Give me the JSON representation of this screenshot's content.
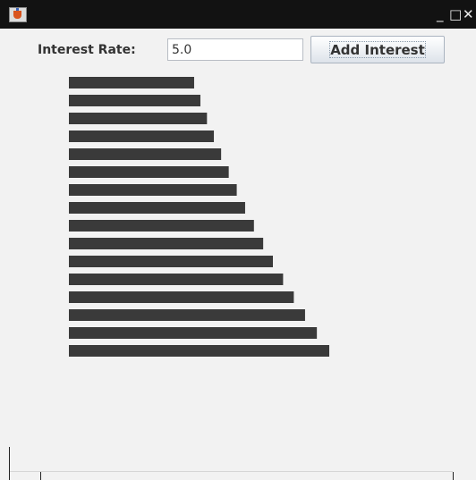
{
  "window": {
    "title": "",
    "controls": {
      "minimize": "_",
      "maximize": "□",
      "close": "✕"
    },
    "app_icon": "java-cup-icon"
  },
  "form": {
    "rate_label": "Interest Rate:",
    "rate_value": "5.0",
    "add_button_label": "Add Interest"
  },
  "colors": {
    "bar": "#3a3a3a",
    "background": "#f2f2f2",
    "titlebar": "#121212"
  },
  "chart_data": {
    "type": "bar",
    "orientation": "horizontal",
    "title": "",
    "xlabel": "",
    "ylabel": "",
    "values": [
      1000,
      1050,
      1102.5,
      1157.63,
      1215.51,
      1276.28,
      1340.1,
      1407.1,
      1477.46,
      1551.33,
      1628.89,
      1710.34,
      1795.86,
      1885.65,
      1979.93,
      2078.93
    ],
    "xlim": [
      0,
      2078.93
    ],
    "grid": false
  }
}
